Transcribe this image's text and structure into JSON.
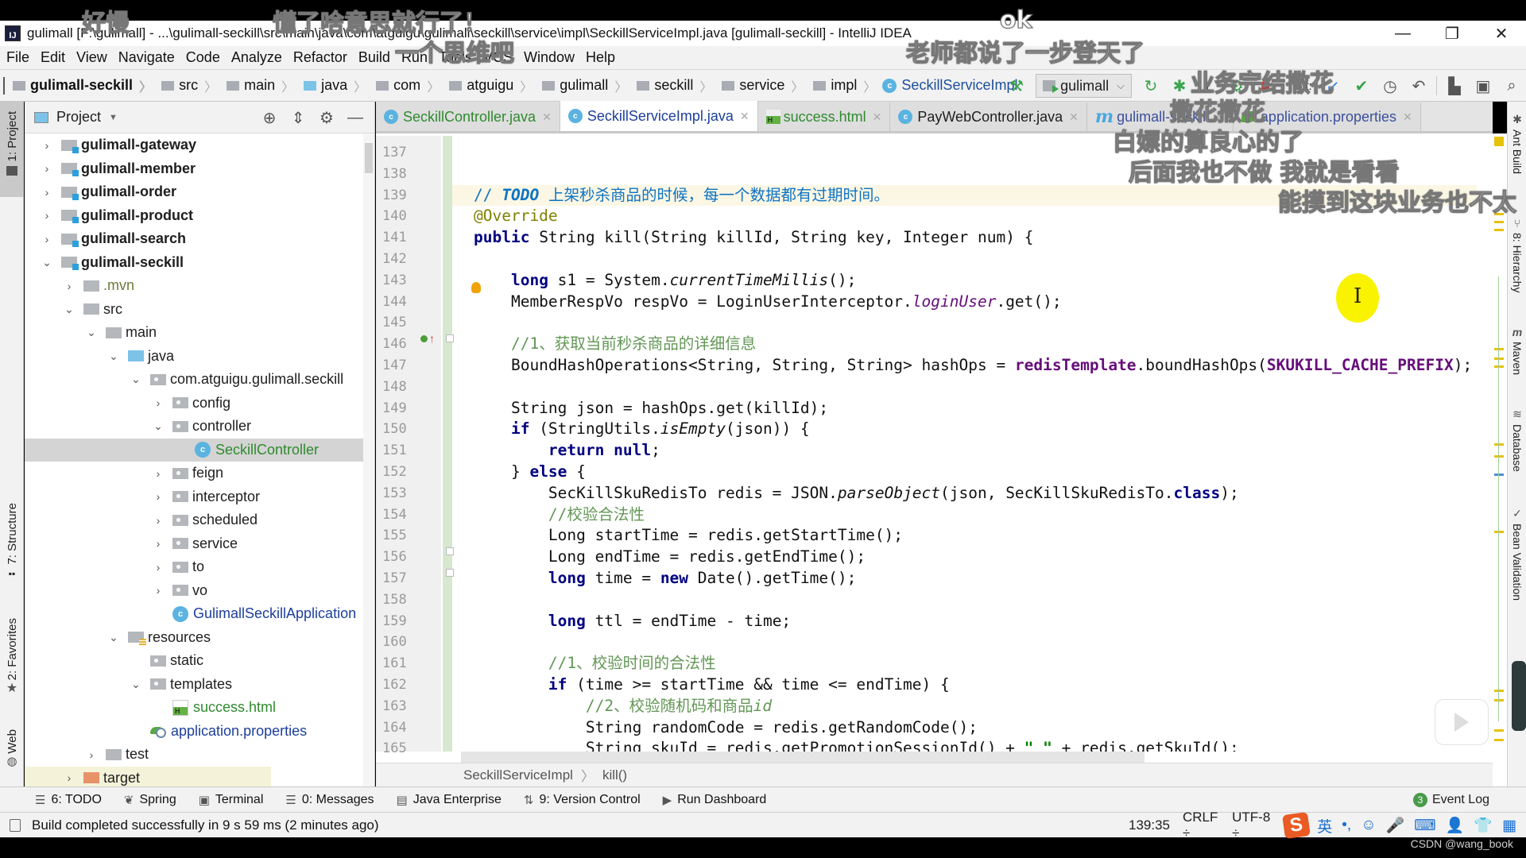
{
  "window": {
    "title": "gulimall [F:\\gulimall] - ...\\gulimall-seckill\\src\\main\\java\\com\\atguigu\\gulimall\\seckill\\service\\impl\\SeckillServiceImpl.java [gulimall-seckill] - IntelliJ IDEA",
    "app_icon": "IJ",
    "minimize": "—",
    "restore": "❐",
    "close": "✕"
  },
  "menu": [
    "File",
    "Edit",
    "View",
    "Navigate",
    "Code",
    "Analyze",
    "Refactor",
    "Build",
    "Run",
    "Tools",
    "VCS",
    "Window",
    "Help"
  ],
  "navbar": {
    "crumbs": [
      "gulimall-seckill",
      "src",
      "main",
      "java",
      "com",
      "atguigu",
      "gulimall",
      "seckill",
      "service",
      "impl"
    ],
    "current_class": "SeckillServiceImpl",
    "run_config": "gulimall",
    "vcs_label": "Git:"
  },
  "left_tools": {
    "project": "1: Project",
    "structure": "7: Structure",
    "favorites": "2: Favorites",
    "web": "Web"
  },
  "project_panel": {
    "title": "Project",
    "tree": [
      {
        "label": "gulimall-gateway",
        "depth": 0,
        "arrow": "›",
        "icon": "module",
        "style": "bold"
      },
      {
        "label": "gulimall-member",
        "depth": 0,
        "arrow": "›",
        "icon": "module",
        "style": "bold"
      },
      {
        "label": "gulimall-order",
        "depth": 0,
        "arrow": "›",
        "icon": "module",
        "style": "bold"
      },
      {
        "label": "gulimall-product",
        "depth": 0,
        "arrow": "›",
        "icon": "module",
        "style": "bold"
      },
      {
        "label": "gulimall-search",
        "depth": 0,
        "arrow": "›",
        "icon": "module",
        "style": "bold"
      },
      {
        "label": "gulimall-seckill",
        "depth": 0,
        "arrow": "⌄",
        "icon": "module",
        "style": "bold"
      },
      {
        "label": ".mvn",
        "depth": 1,
        "arrow": "›",
        "icon": "folder",
        "style": "olive"
      },
      {
        "label": "src",
        "depth": 1,
        "arrow": "⌄",
        "icon": "folder",
        "style": ""
      },
      {
        "label": "main",
        "depth": 2,
        "arrow": "⌄",
        "icon": "folder",
        "style": ""
      },
      {
        "label": "java",
        "depth": 3,
        "arrow": "⌄",
        "icon": "blue",
        "style": ""
      },
      {
        "label": "com.atguigu.gulimall.seckill",
        "depth": 4,
        "arrow": "⌄",
        "icon": "pkg",
        "style": ""
      },
      {
        "label": "config",
        "depth": 5,
        "arrow": "›",
        "icon": "pkg",
        "style": ""
      },
      {
        "label": "controller",
        "depth": 5,
        "arrow": "⌄",
        "icon": "pkg",
        "style": ""
      },
      {
        "label": "SeckillController",
        "depth": 6,
        "arrow": "",
        "icon": "class",
        "style": "green",
        "selected": true
      },
      {
        "label": "feign",
        "depth": 5,
        "arrow": "›",
        "icon": "pkg",
        "style": ""
      },
      {
        "label": "interceptor",
        "depth": 5,
        "arrow": "›",
        "icon": "pkg",
        "style": ""
      },
      {
        "label": "scheduled",
        "depth": 5,
        "arrow": "›",
        "icon": "pkg",
        "style": ""
      },
      {
        "label": "service",
        "depth": 5,
        "arrow": "›",
        "icon": "pkg",
        "style": ""
      },
      {
        "label": "to",
        "depth": 5,
        "arrow": "›",
        "icon": "pkg",
        "style": ""
      },
      {
        "label": "vo",
        "depth": 5,
        "arrow": "›",
        "icon": "pkg",
        "style": ""
      },
      {
        "label": "GulimallSeckillApplication",
        "depth": 5,
        "arrow": "",
        "icon": "class",
        "style": "blue"
      },
      {
        "label": "resources",
        "depth": 3,
        "arrow": "⌄",
        "icon": "res",
        "style": ""
      },
      {
        "label": "static",
        "depth": 4,
        "arrow": "",
        "icon": "pkg",
        "style": ""
      },
      {
        "label": "templates",
        "depth": 4,
        "arrow": "⌄",
        "icon": "pkg",
        "style": ""
      },
      {
        "label": "success.html",
        "depth": 5,
        "arrow": "",
        "icon": "html",
        "style": "green"
      },
      {
        "label": "application.properties",
        "depth": 4,
        "arrow": "",
        "icon": "props",
        "style": "blue"
      },
      {
        "label": "test",
        "depth": 2,
        "arrow": "›",
        "icon": "folder",
        "style": ""
      },
      {
        "label": "target",
        "depth": 1,
        "arrow": "›",
        "icon": "orange",
        "style": "",
        "excluded": true
      }
    ]
  },
  "editor": {
    "tabs": [
      {
        "label": "SeckillController.java",
        "icon": "class",
        "color": "green",
        "active": false
      },
      {
        "label": "SeckillServiceImpl.java",
        "icon": "class",
        "color": "blue",
        "active": true
      },
      {
        "label": "success.html",
        "icon": "html",
        "color": "green",
        "active": false
      },
      {
        "label": "PayWebController.java",
        "icon": "class",
        "color": "",
        "active": false
      },
      {
        "label": "gulimall-seckill",
        "icon": "maven",
        "color": "purple",
        "active": false
      },
      {
        "label": "application.properties",
        "icon": "props",
        "color": "purple",
        "active": false
      }
    ],
    "line_numbers": [
      "137",
      "138",
      "139",
      "140",
      "141",
      "142",
      "143",
      "144",
      "145",
      "146",
      "147",
      "148",
      "149",
      "150",
      "151",
      "152",
      "153",
      "154",
      "155",
      "156",
      "157",
      "158",
      "159",
      "160",
      "161",
      "162",
      "163",
      "164",
      "165"
    ],
    "lines": [
      "",
      "",
      "<span class=\"cm-todo\">// <i>TODO</i> 上架秒杀商品的时候，每一个数据都有过期时间。</span>",
      "<span class=\"ann\">@Override</span>",
      "<span class=\"kw\">public</span> String kill(String killId, String key, Integer num) {",
      "",
      "    <span class=\"kw\">long</span> s1 = System.<span class=\"it\">currentTimeMillis</span>();",
      "    MemberRespVo respVo = LoginUserInterceptor.<span class=\"it\" style=\"color:#660e7a\">loginUser</span>.get();",
      "",
      "    <span class=\"cm\">//1、获取当前秒杀商品的详细信息</span>",
      "    BoundHashOperations&lt;String, String, String&gt; hashOps = <span class=\"fld\">redisTemplate</span>.boundHashOps(<span class=\"fld\">SKUKILL_CACHE_PREFIX</span>);",
      "",
      "    String json = hashOps.get(killId);",
      "    <span class=\"kw\">if</span> (StringUtils.<span class=\"it\">isEmpty</span>(json)) {",
      "        <span class=\"kw\">return null</span>;",
      "    } <span class=\"kw\">else</span> {",
      "        SecKillSkuRedisTo redis = JSON.<span class=\"it\">parseObject</span>(json, SecKillSkuRedisTo.<span class=\"kw\">class</span>);",
      "        <span class=\"cm\">//校验合法性</span>",
      "        Long startTime = redis.getStartTime();",
      "        Long endTime = redis.getEndTime();",
      "        <span class=\"kw\">long</span> time = <span class=\"kw\">new</span> Date().getTime();",
      "",
      "        <span class=\"kw\">long</span> ttl = endTime - time;",
      "",
      "        <span class=\"cm\">//1、校验时间的合法性</span>",
      "        <span class=\"kw\">if</span> (time &gt;= startTime &amp;&amp; time &lt;= endTime) {",
      "            <span class=\"cm\">//2、校验随机码和商品<i>id</i></span>",
      "            String randomCode = redis.getRandomCode();",
      "            String skuId = redis.getPromotionSessionId() + <span class=\"str\">\"_\"</span> + redis.getSkuId();"
    ],
    "breadcrumb": [
      "SeckillServiceImpl",
      "kill()"
    ]
  },
  "right_tools": [
    "Ant Build",
    "8: Hierarchy",
    "Maven",
    "Database",
    "Bean Validation"
  ],
  "bottom_tools": [
    {
      "label": "6: TODO",
      "icon": "☰"
    },
    {
      "label": "Spring",
      "icon": "❦"
    },
    {
      "label": "Terminal",
      "icon": "▣"
    },
    {
      "label": "0: Messages",
      "icon": "☰"
    },
    {
      "label": "Java Enterprise",
      "icon": "▤"
    },
    {
      "label": "9: Version Control",
      "icon": "⇅"
    },
    {
      "label": "Run Dashboard",
      "icon": "▶"
    }
  ],
  "event_log": {
    "label": "Event Log",
    "count": "3"
  },
  "status": {
    "message": "Build completed successfully in 9 s 59 ms (2 minutes ago)",
    "position": "139:35",
    "line_sep": "CRLF ÷",
    "encoding": "UTF-8 ÷"
  },
  "ime": {
    "logo": "S",
    "lang": "英",
    "items": [
      "•,",
      "☺",
      "🎤",
      "⌨",
      "👤",
      "👕",
      "▦"
    ]
  },
  "watermark": "CSDN @wang_book",
  "danmaku": [
    {
      "text": "好慢"
    },
    {
      "text": "懂了啥意思就行了！"
    },
    {
      "text": "一个思维吧"
    },
    {
      "text": "ok"
    },
    {
      "text": "老师都说了一步登天了"
    },
    {
      "text": "业务完结撒花"
    },
    {
      "text": "撒花撒花"
    },
    {
      "text": "白嫖的算良心的了"
    },
    {
      "text": "后面我也不做  我就是看看"
    },
    {
      "text": "能摸到这块业务也不太"
    }
  ]
}
